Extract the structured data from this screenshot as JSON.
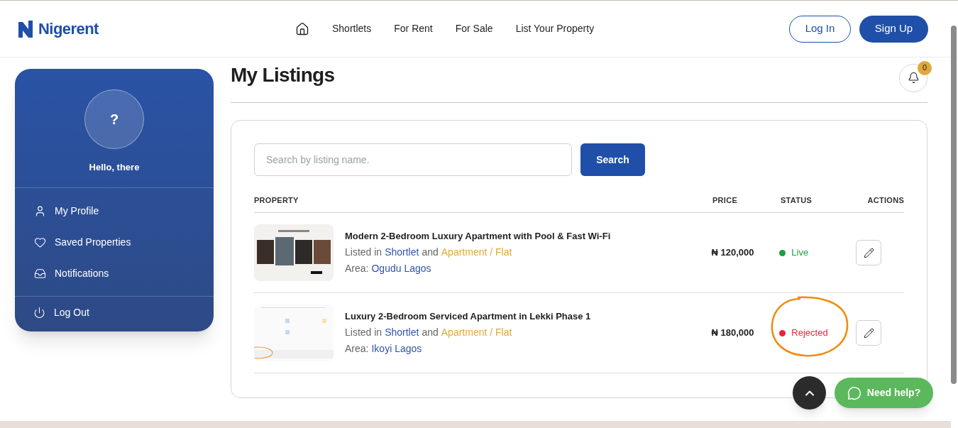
{
  "header": {
    "brand": "Nigerent",
    "nav": [
      {
        "kind": "home"
      },
      {
        "kind": "link",
        "label": "Shortlets"
      },
      {
        "kind": "link",
        "label": "For Rent"
      },
      {
        "kind": "link",
        "label": "For Sale"
      },
      {
        "kind": "link",
        "label": "List Your Property"
      }
    ],
    "login": "Log In",
    "signup": "Sign Up"
  },
  "sidebar": {
    "avatar": "?",
    "greeting": "Hello, there",
    "items": [
      {
        "label": "My Profile"
      },
      {
        "label": "Saved Properties"
      },
      {
        "label": "Notifications"
      }
    ],
    "logout": "Log Out"
  },
  "page_title": "My Listings",
  "notifications_count": "0",
  "search": {
    "placeholder": "Search by listing name.",
    "button": "Search"
  },
  "table": {
    "columns": [
      "PROPERTY",
      "PRICE",
      "STATUS",
      "ACTIONS"
    ],
    "rows": [
      {
        "title": "Modern 2-Bedroom Luxury Apartment with Pool & Fast Wi-Fi",
        "listed_prefix": "Listed in",
        "category": "Shortlet",
        "joiner": "and",
        "type": "Apartment / Flat",
        "area_label": "Area:",
        "area": "Ogudu Lagos",
        "price": "₦ 120,000",
        "status": {
          "label": "Live",
          "color": "#1f9d3f"
        },
        "annotated": false
      },
      {
        "title": "Luxury 2-Bedroom Serviced Apartment in Lekki Phase 1",
        "listed_prefix": "Listed in",
        "category": "Shortlet",
        "joiner": "and",
        "type": "Apartment / Flat",
        "area_label": "Area:",
        "area": "Ikoyi Lagos",
        "price": "₦ 180,000",
        "status": {
          "label": "Rejected",
          "color": "#e8243c"
        },
        "annotated": true
      }
    ]
  },
  "help_button": "Need help?"
}
